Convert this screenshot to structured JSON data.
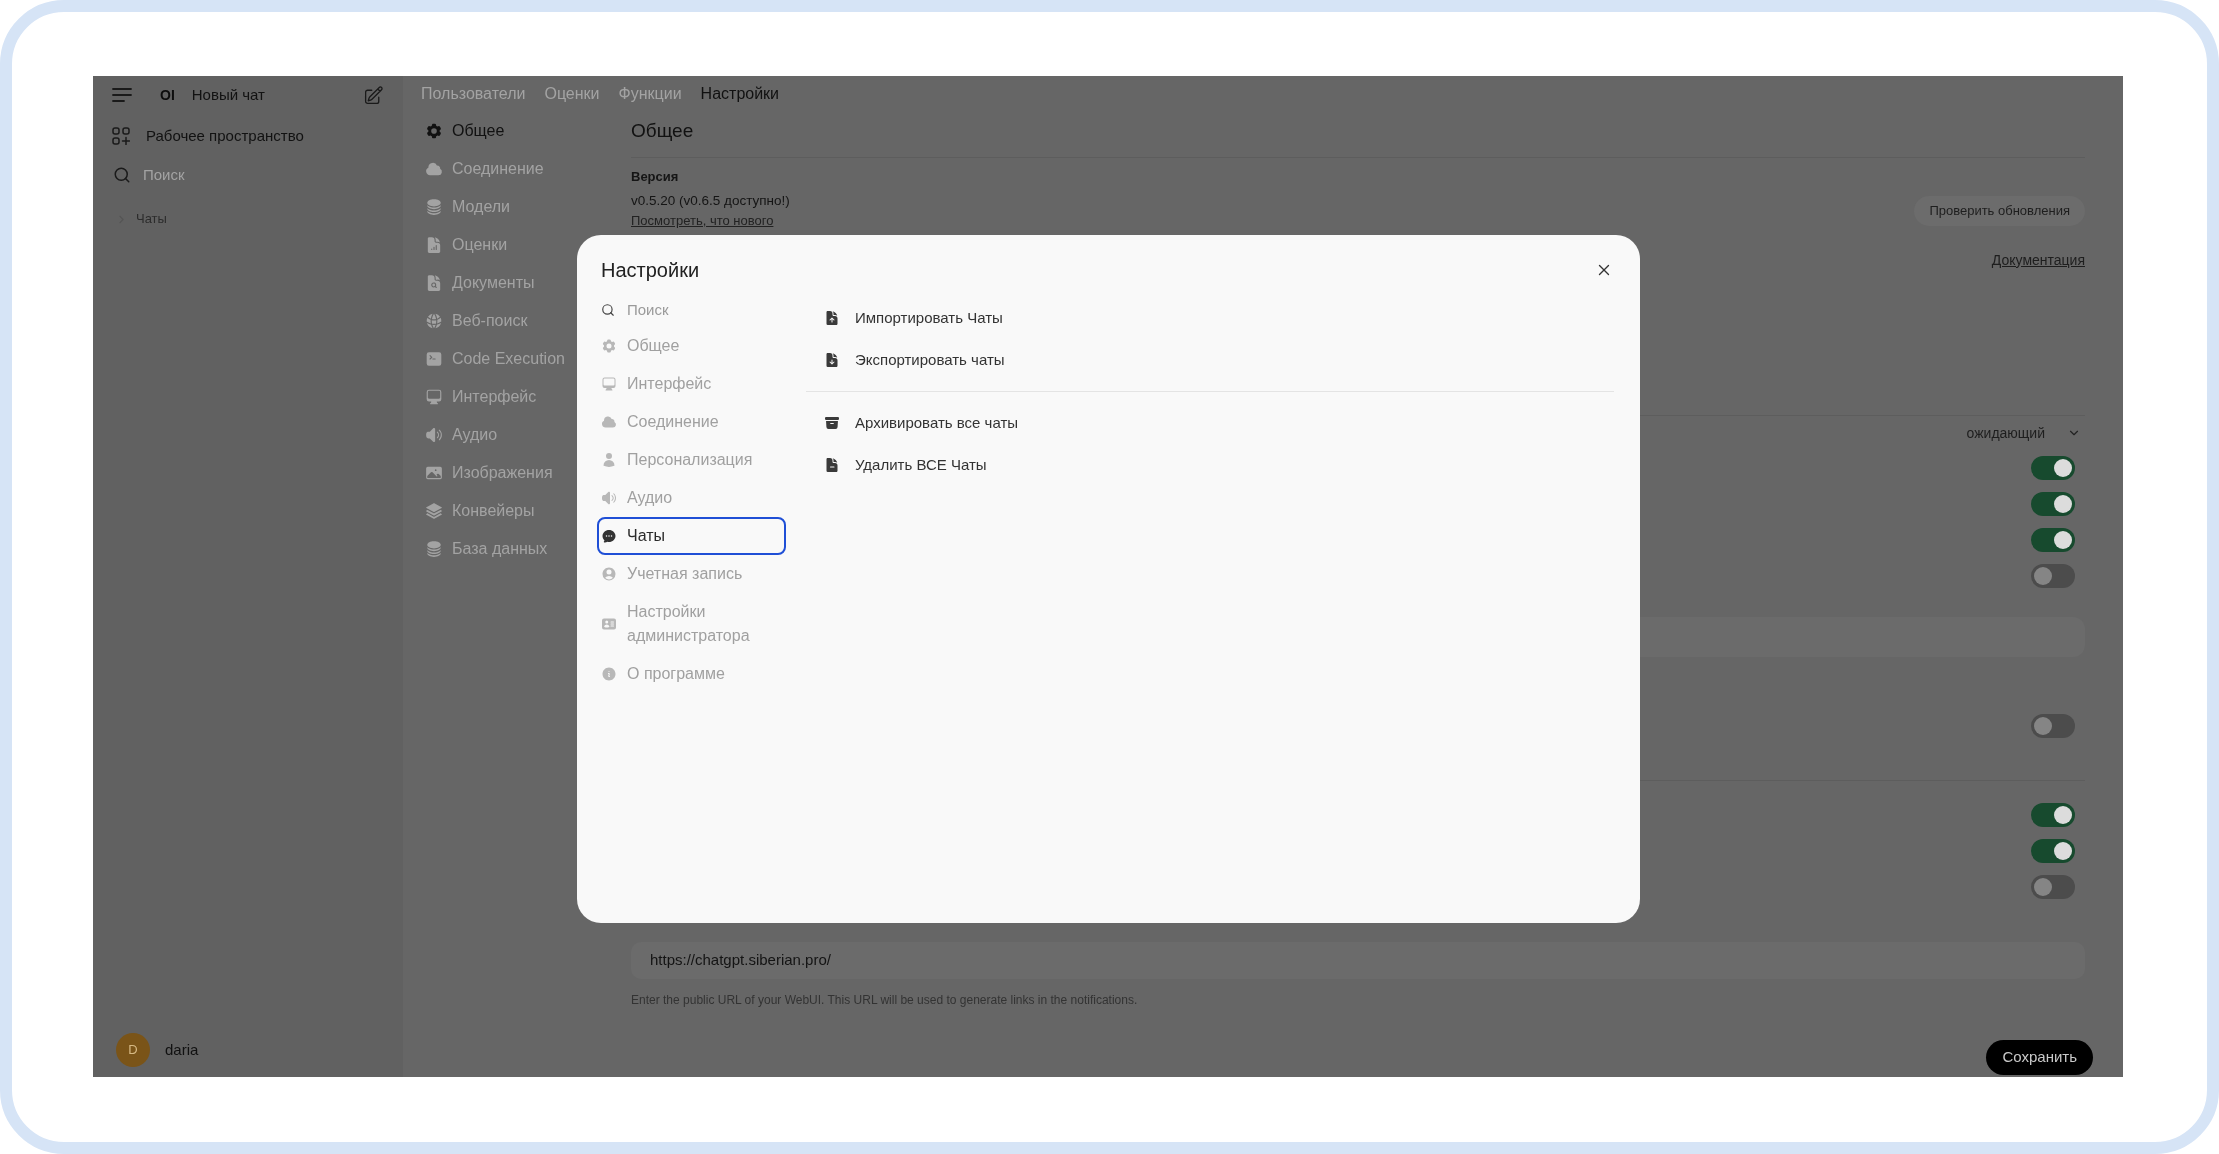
{
  "sidebar": {
    "logo": "OI",
    "new_chat": "Новый чат",
    "workspace": "Рабочее пространство",
    "search": {
      "placeholder": "Поиск"
    },
    "folders": [
      {
        "label": "Чаты",
        "expanded": false
      }
    ],
    "user": {
      "initial": "D",
      "name": "daria"
    }
  },
  "admin": {
    "tabs": [
      {
        "label": "Пользователи",
        "selected": false
      },
      {
        "label": "Оценки",
        "selected": false
      },
      {
        "label": "Функции",
        "selected": false
      },
      {
        "label": "Настройки",
        "selected": true
      }
    ],
    "nav": [
      {
        "label": "Общее",
        "selected": true
      },
      {
        "label": "Соединение",
        "selected": false
      },
      {
        "label": "Модели",
        "selected": false
      },
      {
        "label": "Оценки",
        "selected": false
      },
      {
        "label": "Документы",
        "selected": false
      },
      {
        "label": "Веб-поиск",
        "selected": false
      },
      {
        "label": "Code Execution",
        "selected": false
      },
      {
        "label": "Интерфейс",
        "selected": false
      },
      {
        "label": "Аудио",
        "selected": false
      },
      {
        "label": "Изображения",
        "selected": false
      },
      {
        "label": "Конвейеры",
        "selected": false
      },
      {
        "label": "База данных",
        "selected": false
      }
    ],
    "general": {
      "title": "Общее",
      "version_label": "Версия",
      "version": "v0.5.20 (v0.6.5 доступно!)",
      "whats_new": "Посмотреть, что нового",
      "check_updates": "Проверить обновления",
      "docs": "Документация",
      "select_value": "ожидающий",
      "toggle_groups": [
        [
          {
            "on": true
          },
          {
            "on": true
          },
          {
            "on": true
          },
          {
            "on": false
          }
        ],
        [
          {
            "on": false
          }
        ],
        [
          {
            "on": true
          },
          {
            "on": true
          },
          {
            "on": false
          }
        ]
      ],
      "webui_url": {
        "value": "https://chatgpt.siberian.pro/",
        "hint": "Enter the public URL of your WebUI. This URL will be used to generate links in the notifications."
      }
    },
    "save_button": "Сохранить"
  },
  "modal": {
    "title": "Настройки",
    "search": {
      "placeholder": "Поиск"
    },
    "nav": [
      {
        "label": "Общее",
        "selected": false
      },
      {
        "label": "Интерфейс",
        "selected": false
      },
      {
        "label": "Соединение",
        "selected": false
      },
      {
        "label": "Персонализация",
        "selected": false
      },
      {
        "label": "Аудио",
        "selected": false
      },
      {
        "label": "Чаты",
        "selected": true
      },
      {
        "label": "Учетная запись",
        "selected": false
      },
      {
        "label": "Настройки администратора",
        "selected": false
      },
      {
        "label": "О программе",
        "selected": false
      }
    ],
    "action_groups": [
      [
        "Импортировать Чаты",
        "Экспортировать чаты"
      ],
      [
        "Архивировать все чаты",
        "Удалить ВСЕ Чаты"
      ]
    ]
  }
}
